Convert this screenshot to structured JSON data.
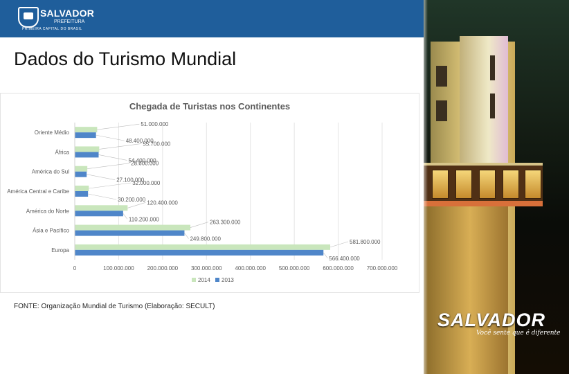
{
  "header": {
    "logo_name": "SALVADOR",
    "logo_sub": "PREFEITURA",
    "logo_tagline": "PRIMEIRA CAPITAL DO BRASIL"
  },
  "slide": {
    "title": "Dados do Turismo Mundial",
    "source": "FONTE: Organização Mundial de Turismo  (Elaboração: SECULT)"
  },
  "photo": {
    "brand": "SALVADOR",
    "slogan": "Você sente que é diferente"
  },
  "colors": {
    "header_blue": "#1f5e9b",
    "series_2014": "#c9e6bc",
    "series_2013": "#4f86c9"
  },
  "chart_data": {
    "type": "bar",
    "orientation": "horizontal",
    "title": "Chegada de Turistas nos Continentes",
    "categories": [
      "Oriente Médio",
      "África",
      "América do Sul",
      "América Central e Caribe",
      "América do Norte",
      "Ásia e Pacífico",
      "Europa"
    ],
    "series": [
      {
        "name": "2014",
        "values": [
          51000000,
          55700000,
          28600000,
          32000000,
          120400000,
          263300000,
          581800000
        ],
        "labels": [
          "51.000.000",
          "55.700.000",
          "28.600.000",
          "32.000.000",
          "120.400.000",
          "263.300.000",
          "581.800.000"
        ]
      },
      {
        "name": "2013",
        "values": [
          48400000,
          54400000,
          27100000,
          30200000,
          110200000,
          249800000,
          566400000
        ],
        "labels": [
          "48.400.000",
          "54.400.000",
          "27.100.000",
          "30.200.000",
          "110.200.000",
          "249.800.000",
          "566.400.000"
        ]
      }
    ],
    "xticks": [
      "0",
      "100.000.000",
      "200.000.000",
      "300.000.000",
      "400.000.000",
      "500.000.000",
      "600.000.000",
      "700.000.000"
    ],
    "xlim": [
      0,
      700000000
    ],
    "grid": true,
    "legend": "bottom"
  }
}
